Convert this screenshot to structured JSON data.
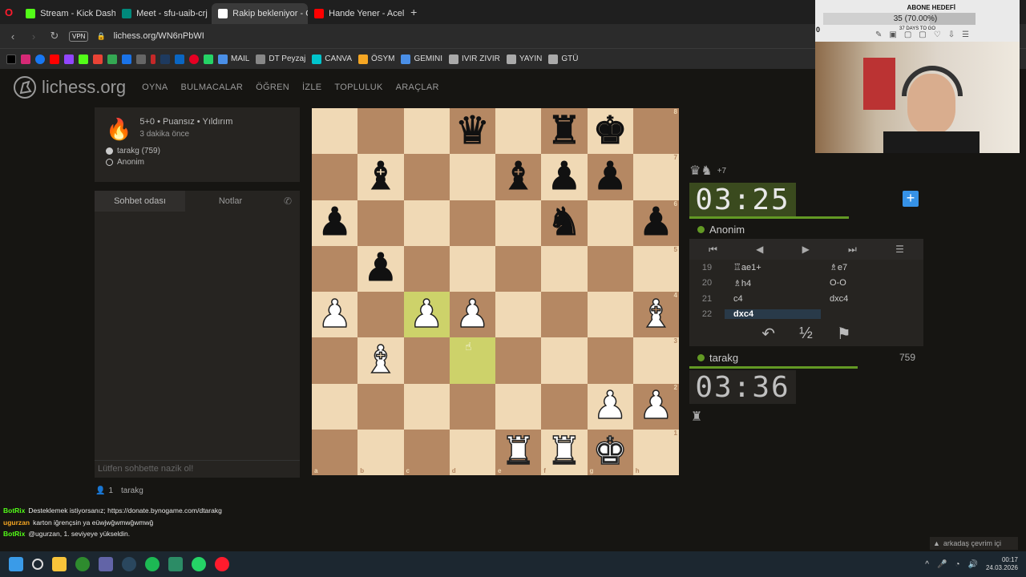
{
  "browser": {
    "tabs": [
      {
        "label": "Stream - Kick Dashboard",
        "color": "#53fc18",
        "active": false
      },
      {
        "label": "Meet - sfu-uaib-crj",
        "color": "#00897b",
        "active": false
      },
      {
        "label": "Rakip bekleniyor - Oyu",
        "color": "#ffffff",
        "active": true
      },
      {
        "label": "Hande Yener - Acele E",
        "color": "#ff0000",
        "active": false
      }
    ],
    "new_tab": "+",
    "vpn_label": "VPN",
    "url": "lichess.org/WN6nPbWI",
    "bookmarks": [
      {
        "label": "MAIL",
        "color": "#4a8fe7"
      },
      {
        "label": "DT Peyzaj",
        "color": "#888888"
      },
      {
        "label": "CANVA",
        "color": "#00c4cc"
      },
      {
        "label": "ÖSYM",
        "color": "#f5a623"
      },
      {
        "label": "GEMINI",
        "color": "#4a8fe7"
      },
      {
        "label": "IVIR ZIVIR",
        "color": "#aaaaaa"
      },
      {
        "label": "YAYIN",
        "color": "#aaaaaa"
      },
      {
        "label": "GTÜ",
        "color": "#aaaaaa"
      }
    ]
  },
  "site": {
    "logo": "lichess.org",
    "nav": [
      "OYNA",
      "BULMACALAR",
      "ÖĞREN",
      "İZLE",
      "TOPLULUK",
      "ARAÇLAR"
    ]
  },
  "game_info": {
    "mode": "5+0 • Puansız • Yıldırım",
    "time_ago": "3 dakika önce",
    "white_player": "tarakg (759)",
    "black_player": "Anonim"
  },
  "chat": {
    "tab_chat": "Sohbet odası",
    "tab_notes": "Notlar",
    "placeholder": "Lütfen sohbette nazik ol!",
    "spectators": "1",
    "spectator_name": "tarakg"
  },
  "board": {
    "ranks": [
      "8",
      "7",
      "6",
      "5",
      "4",
      "3",
      "2",
      "1"
    ],
    "files": [
      "a",
      "b",
      "c",
      "d",
      "e",
      "f",
      "g",
      "h"
    ],
    "position": [
      [
        "",
        "",
        "",
        "bq",
        "",
        "br",
        "bk",
        ""
      ],
      [
        "",
        "bb",
        "",
        "",
        "bb",
        "bp",
        "bp",
        ""
      ],
      [
        "bp",
        "",
        "",
        "",
        "",
        "bn",
        "",
        "bp"
      ],
      [
        "",
        "bp",
        "",
        "",
        "",
        "",
        "",
        ""
      ],
      [
        "wp",
        "",
        "wp",
        "wp",
        "",
        "",
        "",
        "wb"
      ],
      [
        "",
        "wb",
        "",
        "",
        "",
        "",
        "",
        ""
      ],
      [
        "",
        "",
        "",
        "",
        "",
        "",
        "wp",
        "wp"
      ],
      [
        "",
        "",
        "",
        "",
        "wr",
        "wr",
        "wk",
        ""
      ]
    ],
    "highlight": [
      "c4",
      "d3"
    ]
  },
  "opponent": {
    "material_icons": "♛♞",
    "material_diff": "+7",
    "clock": "03:25",
    "name": "Anonim"
  },
  "player": {
    "clock": "03:36",
    "name": "tarakg",
    "rating": "759",
    "material_icons": "♜"
  },
  "moves": [
    {
      "num": "19",
      "white": "♖ae1+",
      "black": "♗e7"
    },
    {
      "num": "20",
      "white": "♗h4",
      "black": "O-O"
    },
    {
      "num": "21",
      "white": "c4",
      "black": "dxc4"
    },
    {
      "num": "22",
      "white": "dxc4",
      "black": ""
    }
  ],
  "move_nav": [
    "⏮",
    "◀",
    "▶",
    "⏭",
    "☰"
  ],
  "controls": {
    "takeback": "↶",
    "draw": "½",
    "resign": "⚑"
  },
  "cam": {
    "goal_title": "ABONE HEDEFİ",
    "goal_progress": "35 (70.00%)",
    "goal_fraction": 0.7,
    "goal_days": "37 DAYS TO GO",
    "goal_count": "0"
  },
  "stream_chat": [
    {
      "user": "BotRix",
      "user_color": "#53fc18",
      "text": "Desteklemek istiyorsanız; https://donate.bynogame.com/dtarakg"
    },
    {
      "user": "ugurzan",
      "user_color": "#f5a623",
      "text": "karton iğrençsin ya eüwjwğwmwğwmwğ"
    },
    {
      "user": "BotRix",
      "user_color": "#53fc18",
      "text": "@ugurzan, 1. seviyeye yükseldin."
    }
  ],
  "friends_online": "arkadaş çevrim içi",
  "taskbar": {
    "time": "00:17",
    "date": "24.03.2026"
  }
}
